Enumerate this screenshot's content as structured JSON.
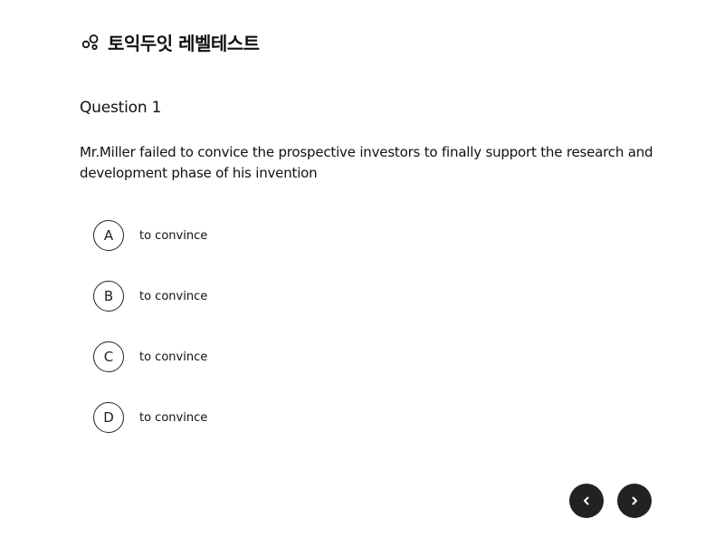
{
  "header": {
    "logo_icon": "molecule-icon",
    "title": "토익두잇 레벨테스트"
  },
  "question": {
    "label": "Question 1",
    "text": "Mr.Miller failed to convice the prospective investors to finally support the research and development phase of his invention"
  },
  "options": [
    {
      "letter": "A",
      "text": "to convince"
    },
    {
      "letter": "B",
      "text": "to convince"
    },
    {
      "letter": "C",
      "text": "to convince"
    },
    {
      "letter": "D",
      "text": "to convince"
    }
  ],
  "navigation": {
    "prev_icon": "chevron-left-icon",
    "next_icon": "chevron-right-icon"
  },
  "colors": {
    "nav_button": "#222222",
    "text": "#111111",
    "background": "#ffffff"
  }
}
